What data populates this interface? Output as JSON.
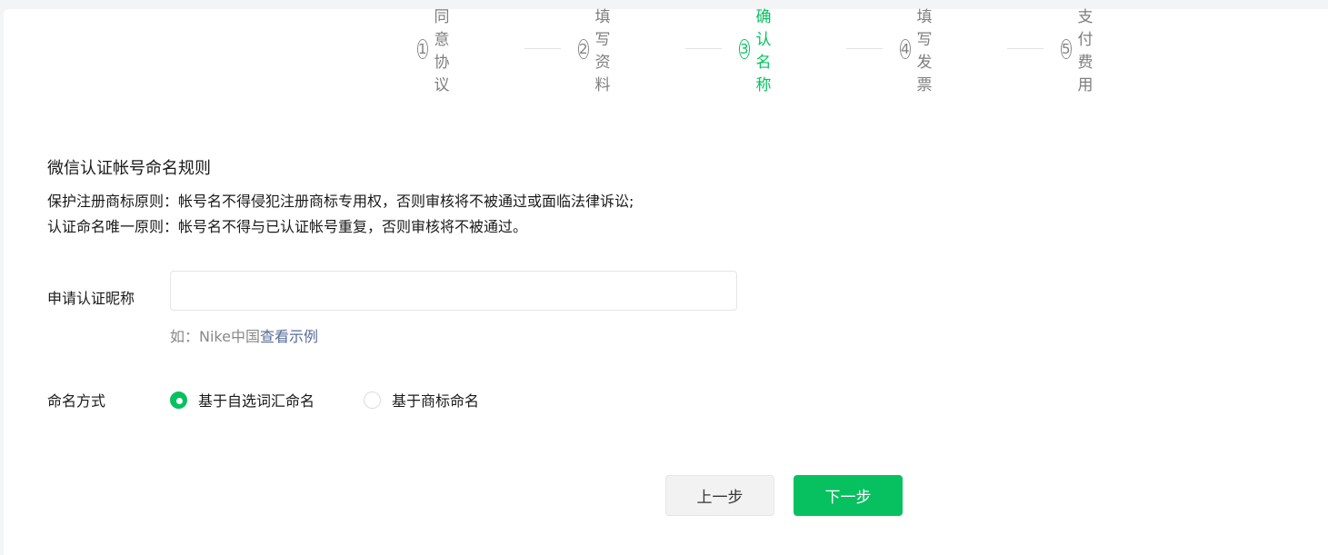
{
  "steps": [
    {
      "num": "1",
      "label": "同意协议"
    },
    {
      "num": "2",
      "label": "填写资料"
    },
    {
      "num": "3",
      "label": "确认名称"
    },
    {
      "num": "4",
      "label": "填写发票"
    },
    {
      "num": "5",
      "label": "支付费用"
    }
  ],
  "active_step": 3,
  "rules": {
    "title": "微信认证帐号命名规则",
    "rule1": "保护注册商标原则：帐号名不得侵犯注册商标专用权，否则审核将不被通过或面临法律诉讼;",
    "rule2": "认证命名唯一原则：帐号名不得与已认证帐号重复，否则审核将不被通过。"
  },
  "form": {
    "nickname_label": "申请认证昵称",
    "nickname_value": "",
    "hint_prefix": "如：Nike中国",
    "hint_link": "查看示例",
    "mode_label": "命名方式",
    "mode_options": [
      "基于自选词汇命名",
      "基于商标命名"
    ],
    "mode_selected": "基于自选词汇命名"
  },
  "buttons": {
    "prev": "上一步",
    "next": "下一步"
  },
  "colors": {
    "accent": "#07c160",
    "link": "#576b95"
  }
}
